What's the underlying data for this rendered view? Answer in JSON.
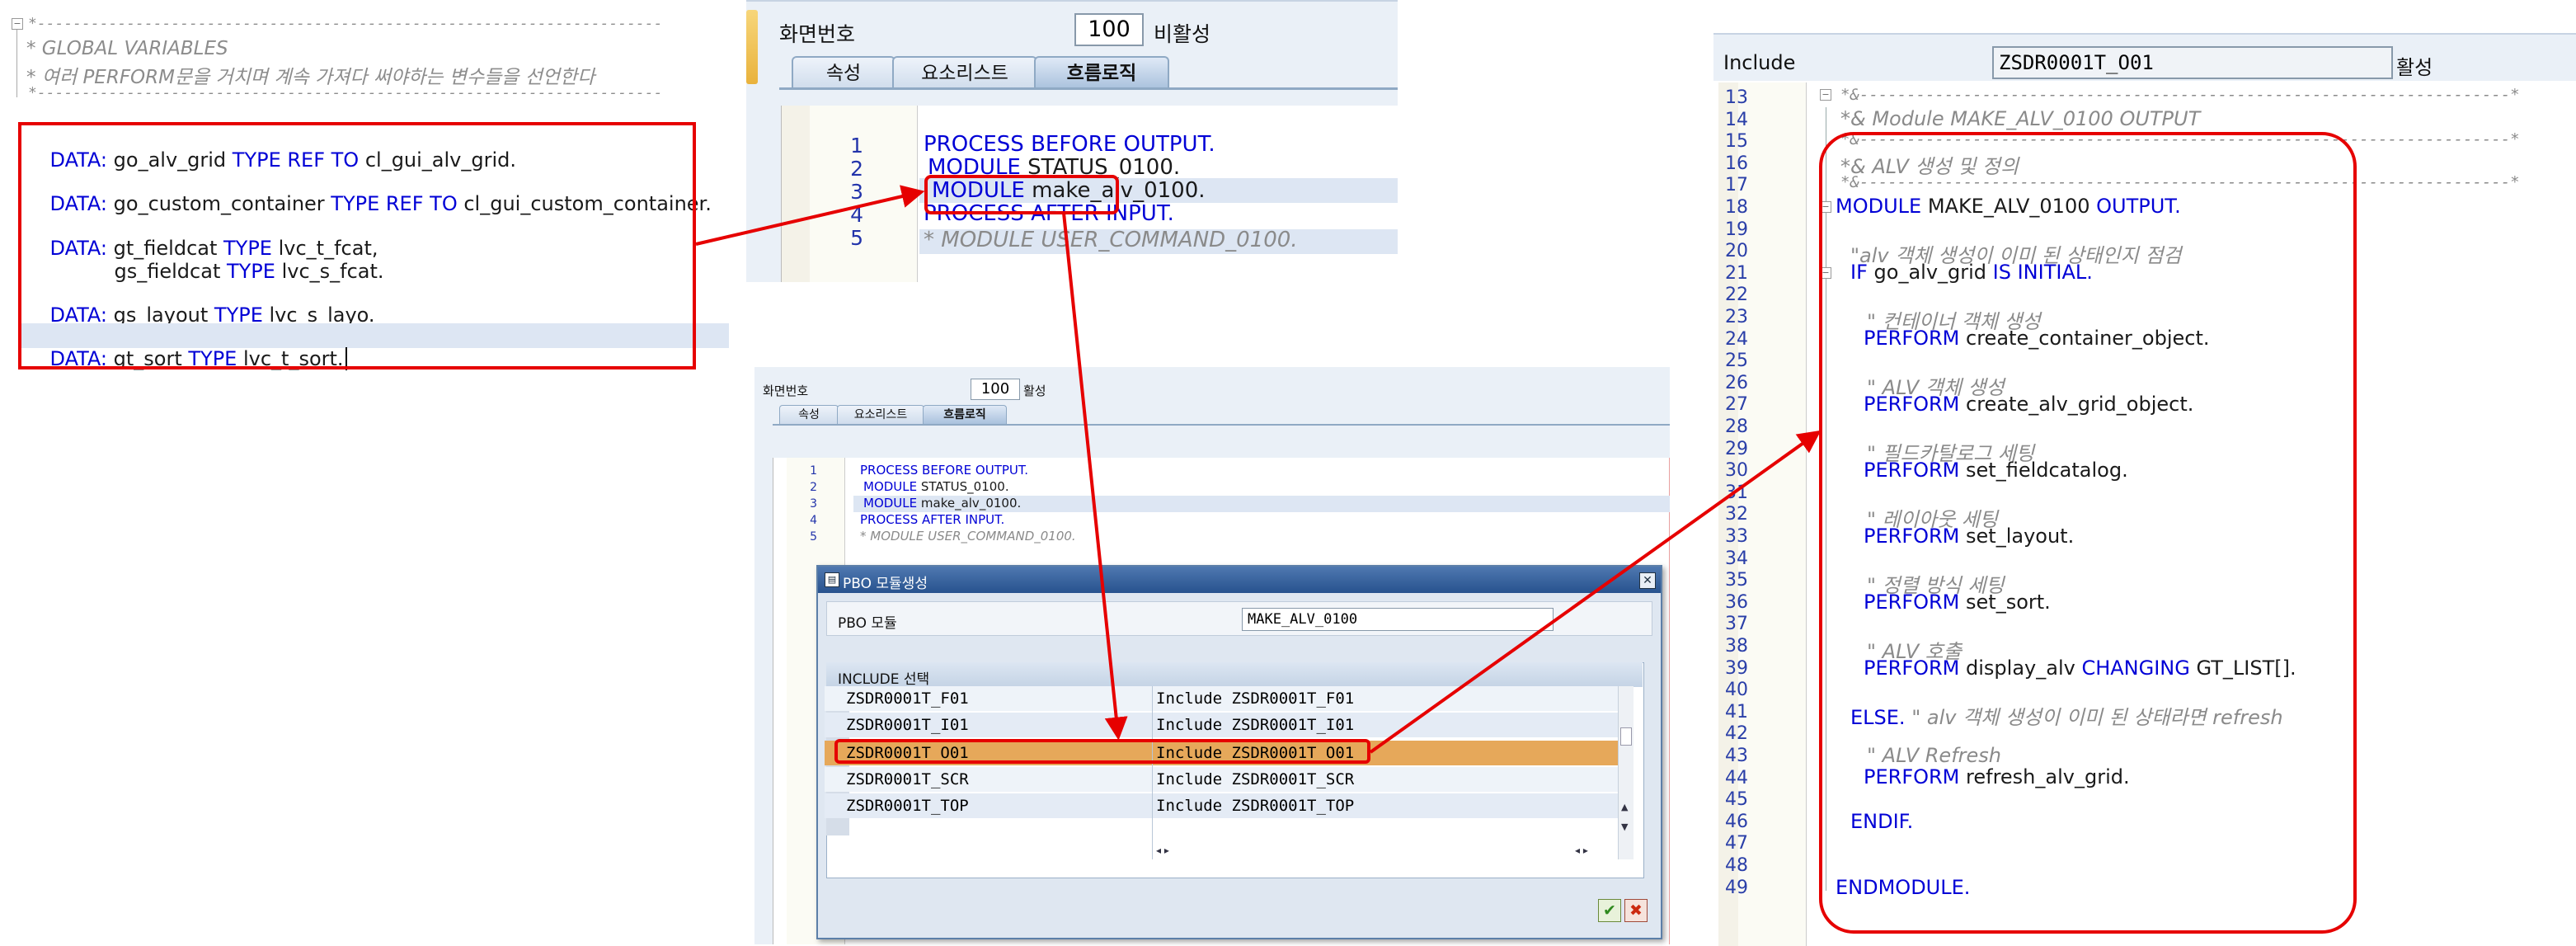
{
  "panel_global": {
    "comment_header": "*----------------------------------------------------------------------",
    "comment_title": "* GLOBAL VARIABLES",
    "comment_desc": "* 여러 PERFORM문을 거치며 계속 가져다 써야하는 변수들을 선언한다",
    "comment_footer": "*----------------------------------------------------------------------",
    "lines": [
      {
        "kw1": "DATA:",
        "id1": " go_alv_grid ",
        "kw2": "TYPE REF TO",
        "id2": " cl_gui_alv_grid."
      },
      {
        "kw1": "DATA:",
        "id1": " go_custom_container ",
        "kw2": "TYPE REF TO",
        "id2": " cl_gui_custom_container."
      },
      {
        "kw1": "DATA:",
        "id1": " gt_fieldcat ",
        "kw2": "TYPE",
        "id2": " lvc_t_fcat,"
      },
      {
        "kw1": "",
        "id1": "gs_fieldcat ",
        "kw2": "TYPE",
        "id2": " lvc_s_fcat."
      },
      {
        "kw1": "DATA:",
        "id1": " gs_layout ",
        "kw2": "TYPE",
        "id2": " lvc_s_layo."
      },
      {
        "kw1": "DATA:",
        "id1": " gt_sort ",
        "kw2": "TYPE",
        "id2": " lvc_t_sort."
      }
    ]
  },
  "panel_flow": {
    "screen_label": "화면번호",
    "screen_number": "100",
    "status": "비활성",
    "tabs": [
      "속성",
      "요소리스트",
      "흐름로직"
    ],
    "line_numbers": [
      "1",
      "2",
      "3",
      "4",
      "5"
    ],
    "lines": {
      "l1": "PROCESS BEFORE OUTPUT.",
      "l2_kw": "MODULE",
      "l2_id": " STATUS_0100.",
      "l3_kw": "MODULE",
      "l3_id": " make_alv_0100.",
      "l4": "PROCESS AFTER INPUT.",
      "l5": "* MODULE USER_COMMAND_0100."
    }
  },
  "panel_dialog": {
    "screen_label": "화면번호",
    "screen_number": "100",
    "status": "활성",
    "tabs": [
      "속성",
      "요소리스트",
      "흐름로직"
    ],
    "line_numbers": [
      "1",
      "2",
      "3",
      "4",
      "5"
    ],
    "lines": {
      "l1": "PROCESS BEFORE OUTPUT.",
      "l2_kw": "MODULE",
      "l2_id": " STATUS_0100.",
      "l3_kw": "MODULE",
      "l3_id": " make_alv_0100.",
      "l4": "PROCESS AFTER INPUT.",
      "l5": "* MODULE USER_COMMAND_0100."
    },
    "dialog": {
      "title": "PBO 모듈생성",
      "module_label": "PBO 모듈",
      "module_value": "MAKE_ALV_0100",
      "include_header": "INCLUDE 선택",
      "rows": [
        {
          "name": "ZSDR0001T_F01",
          "include": "Include ZSDR0001T_F01",
          "selected": false
        },
        {
          "name": "ZSDR0001T_I01",
          "include": "Include ZSDR0001T_I01",
          "selected": false
        },
        {
          "name": "ZSDR0001T_O01",
          "include": "Include ZSDR0001T_O01",
          "selected": true
        },
        {
          "name": "ZSDR0001T_SCR",
          "include": "Include ZSDR0001T_SCR",
          "selected": false
        },
        {
          "name": "ZSDR0001T_TOP",
          "include": "Include ZSDR0001T_TOP",
          "selected": false
        }
      ],
      "confirm_glyph": "✔",
      "cancel_glyph": "✖"
    }
  },
  "panel_include": {
    "label": "Include",
    "name": "ZSDR0001T_O01",
    "status": "활성",
    "line_numbers": [
      "13",
      "14",
      "15",
      "16",
      "17",
      "18",
      "19",
      "20",
      "21",
      "22",
      "23",
      "24",
      "25",
      "26",
      "27",
      "28",
      "29",
      "30",
      "31",
      "32",
      "33",
      "34",
      "35",
      "36",
      "37",
      "38",
      "39",
      "40",
      "41",
      "42",
      "43",
      "44",
      "45",
      "46",
      "47",
      "48",
      "49"
    ],
    "code": {
      "l13": "*&---------------------------------------------------------------------*",
      "l14": "*& Module MAKE_ALV_0100 OUTPUT",
      "l15": "*&---------------------------------------------------------------------*",
      "l16": "*& ALV 생성 및 정의",
      "l17": "*&---------------------------------------------------------------------*",
      "l18_kw": "MODULE",
      "l18_id": " MAKE_ALV_0100 ",
      "l18_kw2": "OUTPUT.",
      "l20": "\"alv 객체 생성이 이미 된 상태인지 점검",
      "l21_kw": "IF",
      "l21_id": " go_alv_grid ",
      "l21_kw2": "IS INITIAL.",
      "l23": "\" 컨테이너 객체 생성",
      "l24_kw": "PERFORM",
      "l24_id": " create_container_object.",
      "l26": "\" ALV 객체 생성",
      "l27_kw": "PERFORM",
      "l27_id": " create_alv_grid_object.",
      "l29": "\" 필드카탈로그 세팅",
      "l30_kw": "PERFORM",
      "l30_id": " set_fieldcatalog.",
      "l32": "\" 레이아웃 세팅",
      "l33_kw": "PERFORM",
      "l33_id": " set_layout.",
      "l35": "\" 정렬 방식 세팅",
      "l36_kw": "PERFORM",
      "l36_id": " set_sort.",
      "l38": "\" ALV 호출",
      "l39_kw": "PERFORM",
      "l39_id": " display_alv ",
      "l39_kw2": "CHANGING",
      "l39_id2": " GT_LIST[].",
      "l41_kw": "ELSE.",
      "l41_cm": " \" alv 객체 생성이 이미 된 상태라면 refresh",
      "l43": "\" ALV Refresh",
      "l44_kw": "PERFORM",
      "l44_id": " refresh_alv_grid.",
      "l46_kw": "ENDIF.",
      "l49_kw": "ENDMODULE."
    }
  },
  "colors": {
    "keyword": "#0000d6",
    "comment": "#8a8a8a",
    "highlight": "#e6a85a",
    "annotation": "#e60000"
  }
}
